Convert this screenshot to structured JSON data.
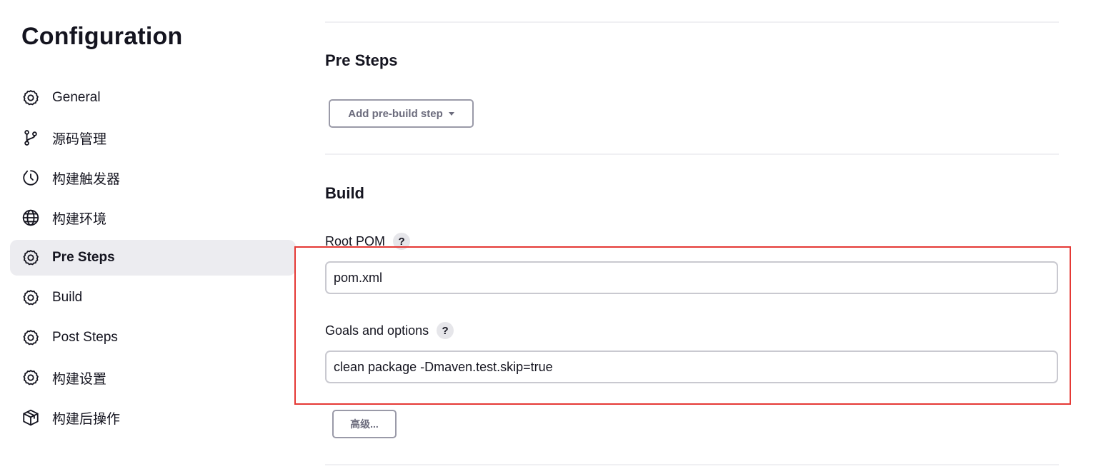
{
  "sidebar": {
    "title": "Configuration",
    "items": [
      {
        "label": "General",
        "icon": "gear-icon",
        "active": false
      },
      {
        "label": "源码管理",
        "icon": "branch-icon",
        "active": false
      },
      {
        "label": "构建触发器",
        "icon": "timer-icon",
        "active": false
      },
      {
        "label": "构建环境",
        "icon": "globe-icon",
        "active": false
      },
      {
        "label": "Pre Steps",
        "icon": "gear-icon",
        "active": true
      },
      {
        "label": "Build",
        "icon": "gear-icon",
        "active": false
      },
      {
        "label": "Post Steps",
        "icon": "gear-icon",
        "active": false
      },
      {
        "label": "构建设置",
        "icon": "gear-icon",
        "active": false
      },
      {
        "label": "构建后操作",
        "icon": "package-icon",
        "active": false
      }
    ]
  },
  "main": {
    "pre_steps": {
      "title": "Pre Steps",
      "add_button_label": "Add pre-build step"
    },
    "build": {
      "title": "Build",
      "root_pom": {
        "label": "Root POM",
        "help": "?",
        "value": "pom.xml"
      },
      "goals": {
        "label": "Goals and options",
        "help": "?",
        "value": "clean package -Dmaven.test.skip=true"
      },
      "advanced_button_label": "高级..."
    }
  },
  "colors": {
    "highlight": "#e53935",
    "active_nav_bg": "#ececf0",
    "text": "#14141f"
  }
}
